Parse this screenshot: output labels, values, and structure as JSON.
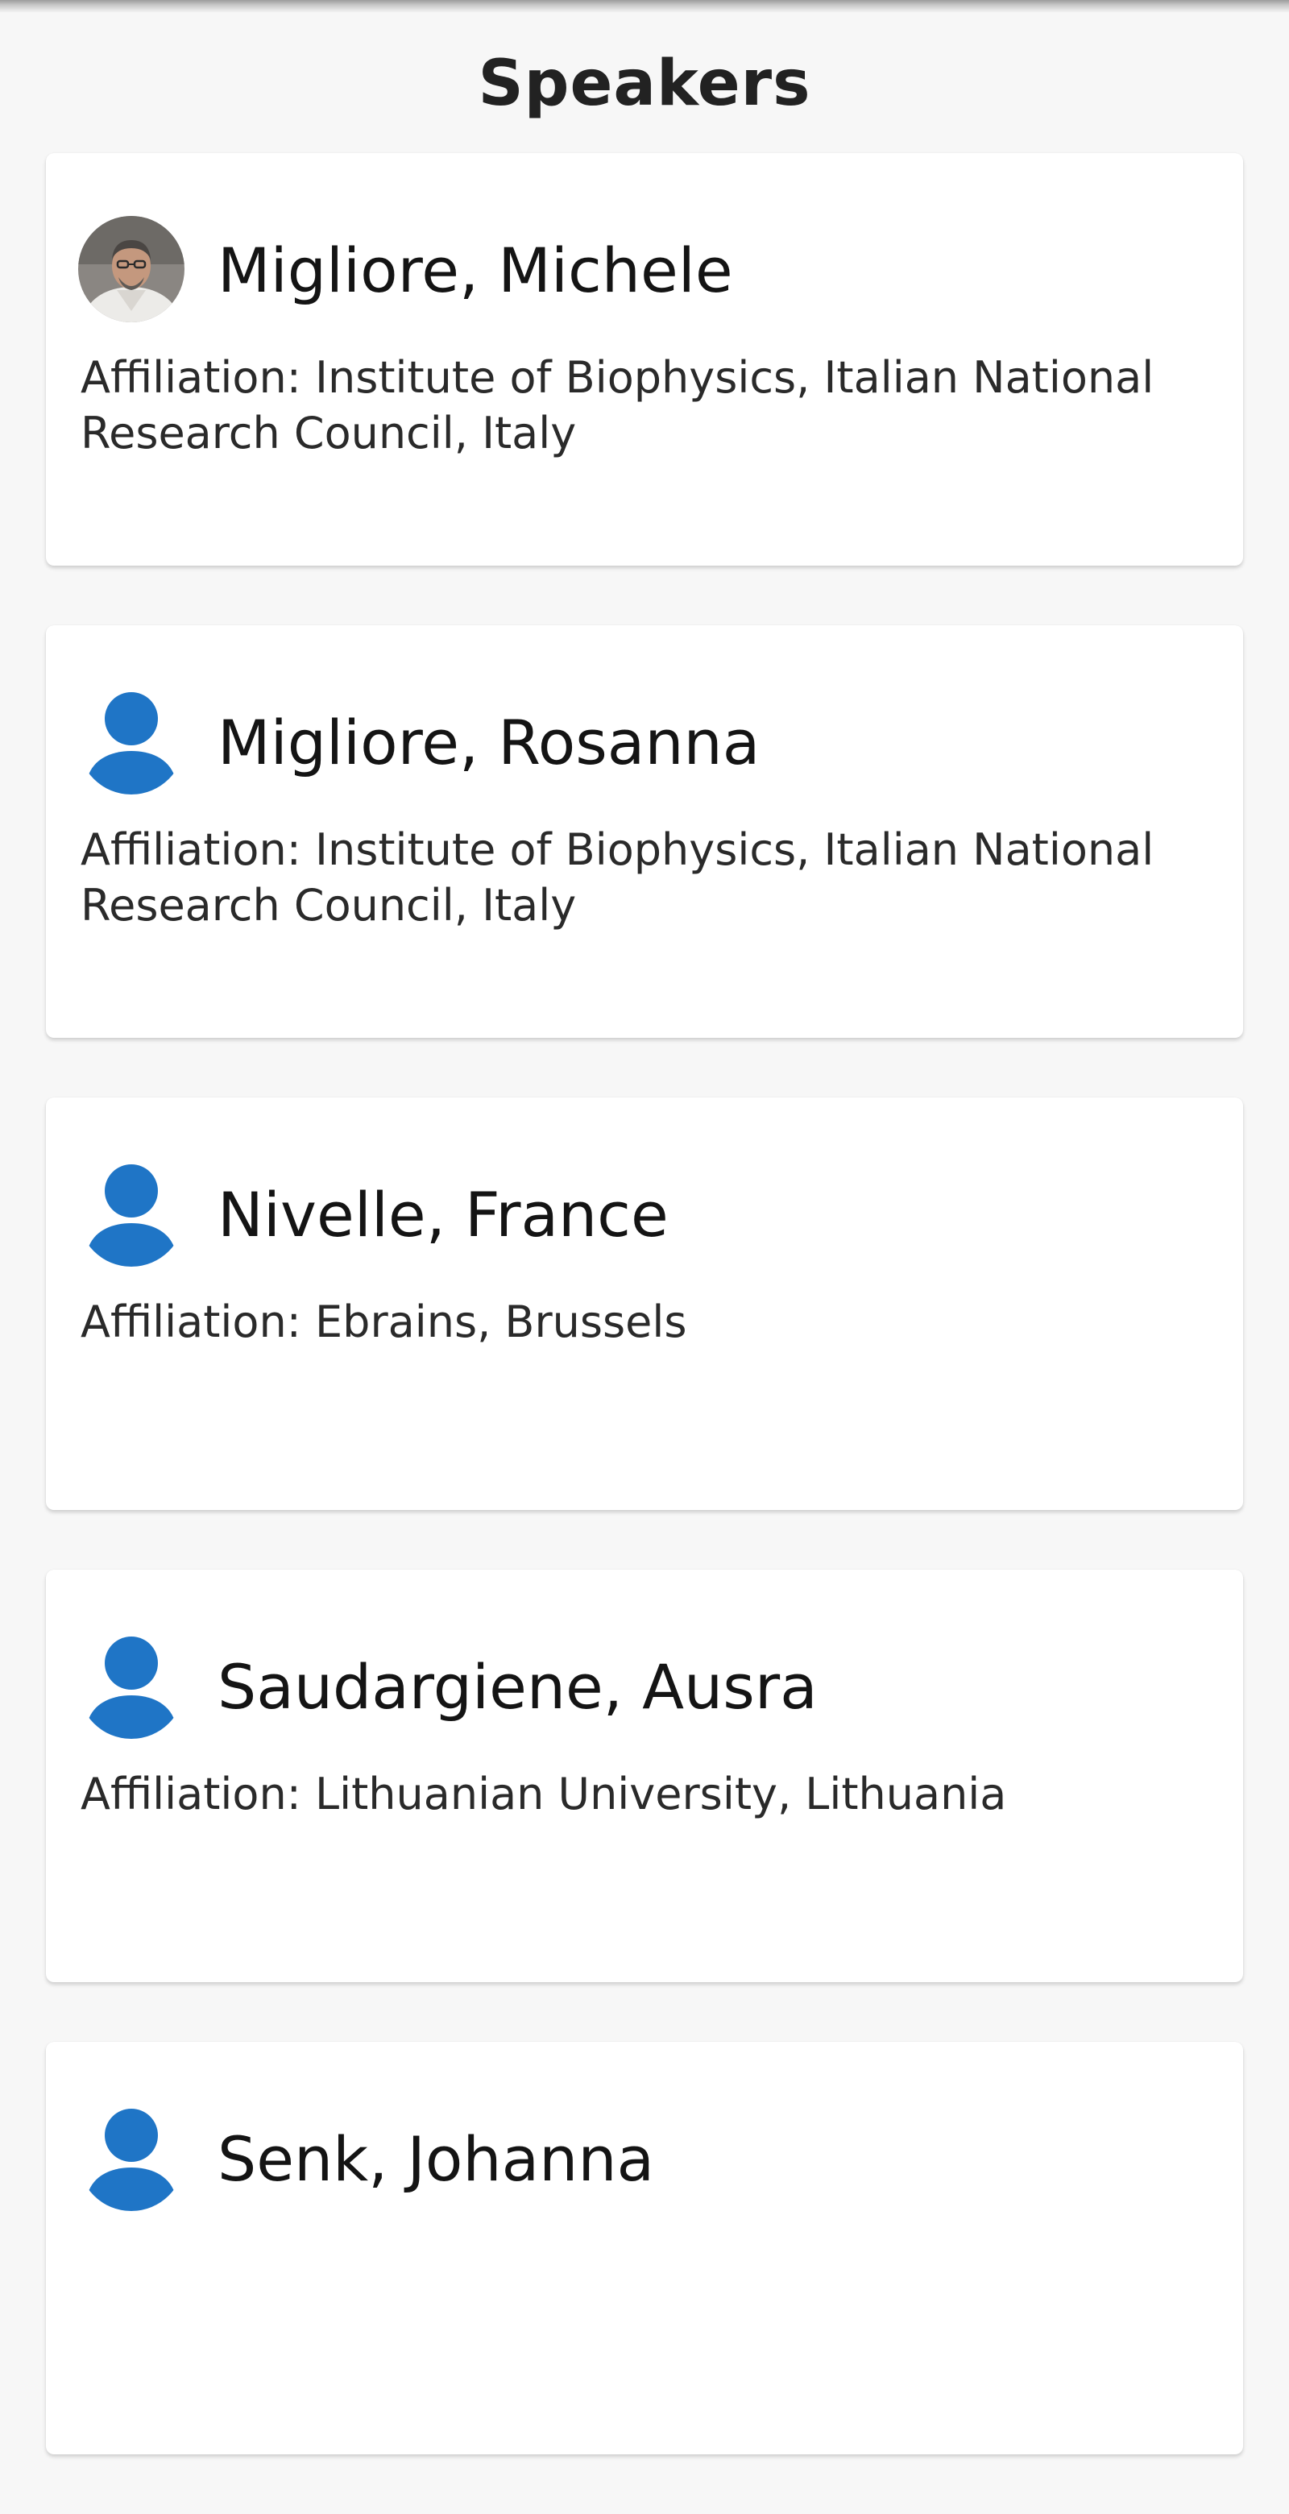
{
  "header": {
    "title": "Speakers"
  },
  "theme": {
    "accent": "#1f75c6",
    "background": "#f7f7f7",
    "card": "#ffffff"
  },
  "speakers": [
    {
      "name": "Migliore, Michele",
      "affiliation": "Affiliation: Institute of Biophysics, Italian National Research Council, Italy",
      "avatar": "photo"
    },
    {
      "name": "Migliore, Rosanna",
      "affiliation": "Affiliation: Institute of Biophysics, Italian National Research Council, Italy",
      "avatar": "person-icon"
    },
    {
      "name": "Nivelle, France",
      "affiliation": "Affiliation: Ebrains, Brussels",
      "avatar": "person-icon"
    },
    {
      "name": "Saudargiene, Ausra",
      "affiliation": "Affiliation: Lithuanian University, Lithuania",
      "avatar": "person-icon"
    },
    {
      "name": "Senk, Johanna",
      "affiliation": "",
      "avatar": "person-icon"
    }
  ]
}
